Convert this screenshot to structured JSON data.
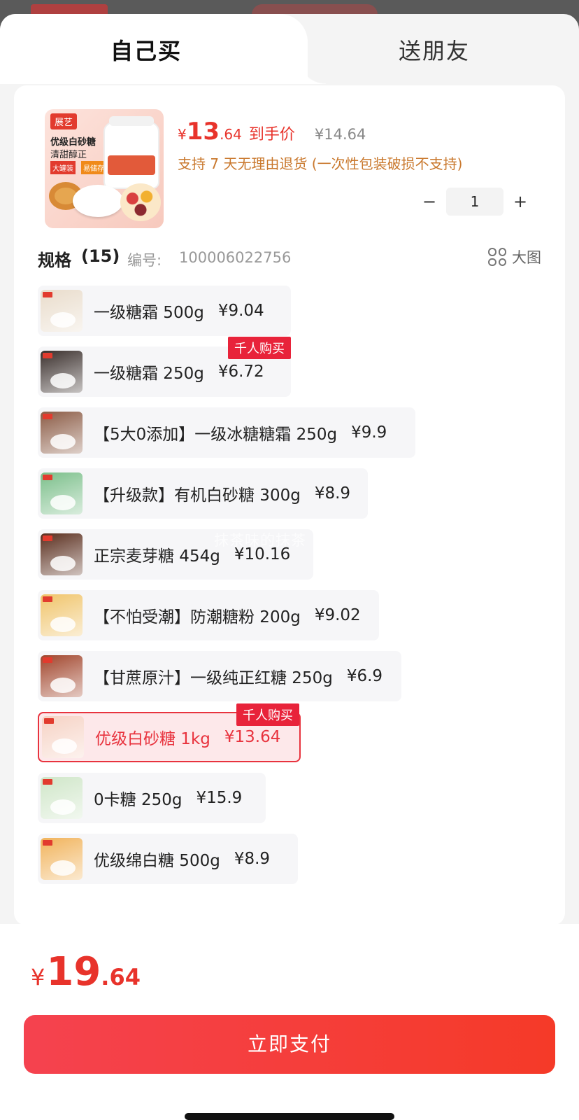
{
  "tabs": {
    "self": "自己买",
    "gift": "送朋友"
  },
  "product": {
    "image": {
      "brand": "展艺",
      "line1": "优级白砂糖",
      "line2": "清甜醇正",
      "tag1": "大罐装",
      "tag2": "易储存"
    },
    "price": {
      "symbol": "¥",
      "integer": "13",
      "decimal": ".64",
      "label": "到手价",
      "original": "¥14.64"
    },
    "return_policy": "支持 7 天无理由退货 (一次性包装破损不支持)"
  },
  "quantity": {
    "minus": "−",
    "value": "1",
    "plus": "+"
  },
  "spec": {
    "title": "规格",
    "count": "(15)",
    "number_label": "编号:",
    "number": "100006022756",
    "big_view": "大图"
  },
  "options": [
    {
      "name": "一级糖霜 500g",
      "price": "¥9.04",
      "badge": null,
      "selected": false,
      "thumb_color": "#e9dccb"
    },
    {
      "name": "一级糖霜 250g",
      "price": "¥6.72",
      "badge": "千人购买",
      "selected": false,
      "thumb_color": "#3a2f2c"
    },
    {
      "name": "【5大0添加】一级冰糖糖霜 250g",
      "price": "¥9.9",
      "badge": null,
      "selected": false,
      "thumb_color": "#8b5b45"
    },
    {
      "name": "【升级款】有机白砂糖 300g",
      "price": "¥8.9",
      "badge": null,
      "selected": false,
      "thumb_color": "#7bbf8a"
    },
    {
      "name": "正宗麦芽糖 454g",
      "price": "¥10.16",
      "badge": null,
      "selected": false,
      "thumb_color": "#5a2e1e"
    },
    {
      "name": "【不怕受潮】防潮糖粉 200g",
      "price": "¥9.02",
      "badge": null,
      "selected": false,
      "thumb_color": "#f0c46a"
    },
    {
      "name": "【甘蔗原汁】一级纯正红糖 250g",
      "price": "¥6.9",
      "badge": null,
      "selected": false,
      "thumb_color": "#a1452c"
    },
    {
      "name": "优级白砂糖 1kg",
      "price": "¥13.64",
      "badge": "千人购买",
      "selected": true,
      "thumb_color": "#f6d2c4"
    },
    {
      "name": "0卡糖 250g",
      "price": "¥15.9",
      "badge": null,
      "selected": false,
      "thumb_color": "#cfe6c8"
    },
    {
      "name": "优级绵白糖 500g",
      "price": "¥8.9",
      "badge": null,
      "selected": false,
      "thumb_color": "#f1b35b"
    }
  ],
  "watermark": "抹茶味的抹茶",
  "total": {
    "symbol": "¥",
    "integer": "19",
    "decimal": ".64"
  },
  "pay_button": "立即支付"
}
